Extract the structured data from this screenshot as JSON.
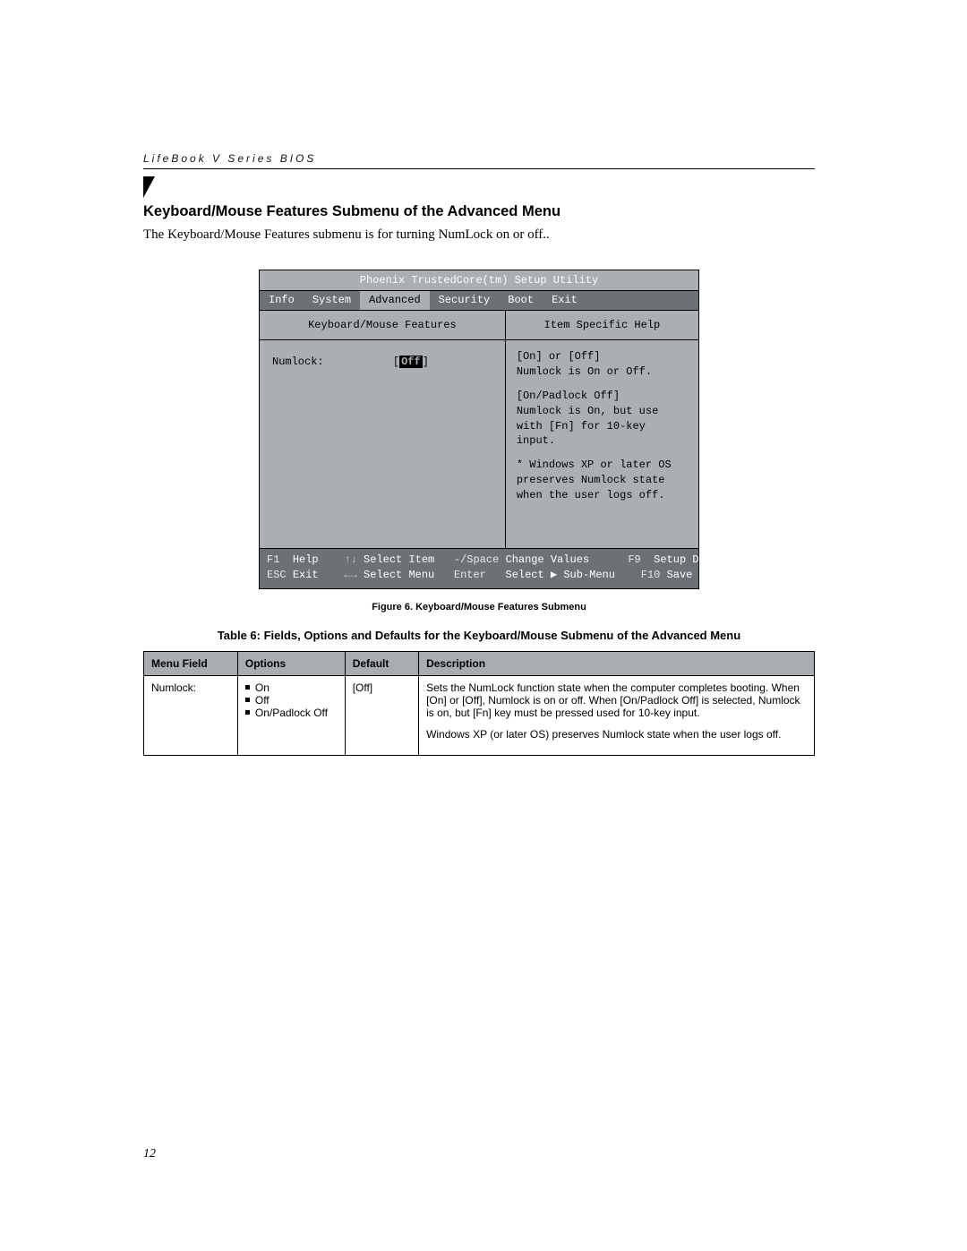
{
  "header": {
    "running": "LifeBook V Series BIOS"
  },
  "section": {
    "title": "Keyboard/Mouse Features Submenu of the Advanced Menu",
    "intro": "The Keyboard/Mouse Features submenu is for turning NumLock on or off.."
  },
  "bios": {
    "title": "Phoenix TrustedCore(tm) Setup Utility",
    "tabs": [
      "Info",
      "System",
      "Advanced",
      "Security",
      "Boot",
      "Exit"
    ],
    "active_tab_index": 2,
    "left_title": "Keyboard/Mouse Features",
    "right_title": "Item Specific Help",
    "field": {
      "label": "Numlock:",
      "value": "Off"
    },
    "help": [
      "[On] or [Off]\nNumlock is On or Off.",
      "[On/Padlock Off]\nNumlock is On, but use with [Fn] for 10-key input.",
      "* Windows XP or later OS preserves Numlock state when the user logs off."
    ],
    "footer": {
      "row1": [
        {
          "key": "F1",
          "label": "Help"
        },
        {
          "arrow": "↑↓",
          "label": "Select Item"
        },
        {
          "key": "-/Space",
          "label": "Change Values"
        },
        {
          "key": "F9",
          "label": "Setup Defaults"
        }
      ],
      "row2": [
        {
          "key": "ESC",
          "label": "Exit"
        },
        {
          "arrow": "←→",
          "label": "Select Menu"
        },
        {
          "key": "Enter",
          "label": "Select ▶ Sub-Menu"
        },
        {
          "key": "F10",
          "label": "Save and Exit"
        }
      ]
    }
  },
  "figure_caption": "Figure 6.  Keyboard/Mouse Features Submenu",
  "table": {
    "title": "Table 6: Fields, Options and Defaults for the Keyboard/Mouse Submenu of the Advanced Menu",
    "headers": [
      "Menu Field",
      "Options",
      "Default",
      "Description"
    ],
    "row": {
      "field": "Numlock:",
      "options": [
        "On",
        "Off",
        "On/Padlock Off"
      ],
      "default": "[Off]",
      "description_p1": "Sets the NumLock function state when the computer completes booting. When [On] or [Off], Numlock is on or off. When [On/Padlock Off] is selected, Numlock is on, but [Fn] key must be pressed used for 10-key input.",
      "description_p2": "Windows XP (or later OS) preserves Numlock state when the user logs off."
    }
  },
  "page_number": "12"
}
